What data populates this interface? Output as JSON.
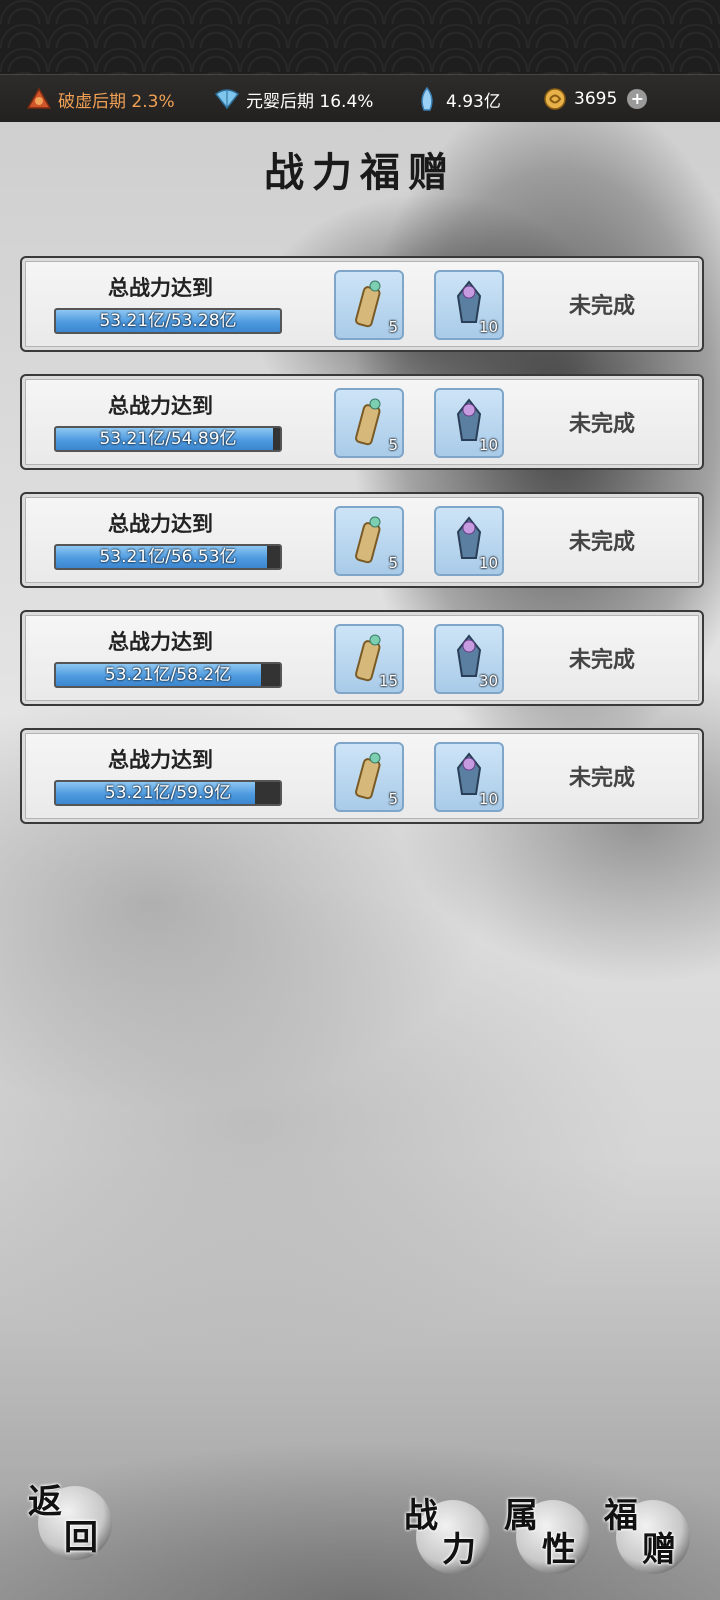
{
  "status_bar": {
    "realm1": "破虚后期 2.3%",
    "realm2": "元婴后期 16.4%",
    "crystal": "4.93亿",
    "currency": "3695",
    "plus": "+"
  },
  "page": {
    "title": "战力福赠"
  },
  "rows": [
    {
      "label": "总战力达到",
      "progress_text": "53.21亿/53.28亿",
      "progress": 0.9987,
      "items": [
        {
          "icon": "scroll-icon",
          "count": "5"
        },
        {
          "icon": "lantern-icon",
          "count": "10"
        }
      ],
      "status": "未完成"
    },
    {
      "label": "总战力达到",
      "progress_text": "53.21亿/54.89亿",
      "progress": 0.9694,
      "items": [
        {
          "icon": "scroll-icon",
          "count": "5"
        },
        {
          "icon": "lantern-icon",
          "count": "10"
        }
      ],
      "status": "未完成"
    },
    {
      "label": "总战力达到",
      "progress_text": "53.21亿/56.53亿",
      "progress": 0.9413,
      "items": [
        {
          "icon": "scroll-icon",
          "count": "5"
        },
        {
          "icon": "lantern-icon",
          "count": "10"
        }
      ],
      "status": "未完成"
    },
    {
      "label": "总战力达到",
      "progress_text": "53.21亿/58.2亿",
      "progress": 0.9143,
      "items": [
        {
          "icon": "scroll-icon",
          "count": "15"
        },
        {
          "icon": "lantern-icon",
          "count": "30"
        }
      ],
      "status": "未完成"
    },
    {
      "label": "总战力达到",
      "progress_text": "53.21亿/59.9亿",
      "progress": 0.8883,
      "items": [
        {
          "icon": "scroll-icon",
          "count": "5"
        },
        {
          "icon": "lantern-icon",
          "count": "10"
        }
      ],
      "status": "未完成"
    }
  ],
  "bottom": {
    "back": [
      "返",
      "回"
    ],
    "tab_power": [
      "战",
      "力"
    ],
    "tab_attr": [
      "属",
      "性"
    ],
    "tab_gift": [
      "福",
      "赠"
    ]
  }
}
